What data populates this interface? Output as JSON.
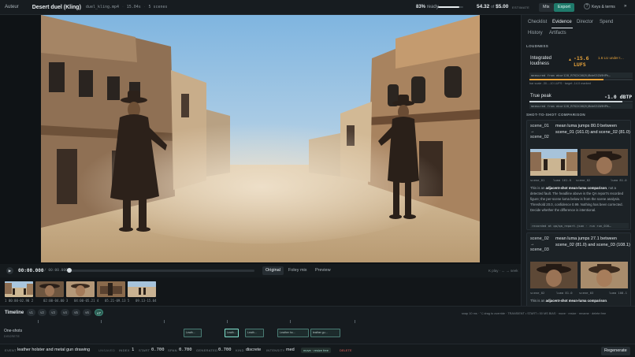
{
  "topbar": {
    "brand": "Auteur",
    "title": "Desert duel (Kling)",
    "file": "duel_kling.mp4",
    "duration": "15.04s",
    "scenes": "5 scenes",
    "ready_pct": "83%",
    "ready_label": "ready",
    "ready_fraction": 0.83,
    "cost_used": "54.32",
    "cost_of": "of",
    "cost_budget": "$5.00",
    "estimate": "ESTIMATE",
    "mix": "Mix",
    "export": "Export",
    "help": "?",
    "keys": "Keys & terms",
    "collapse": "»"
  },
  "viewer": {
    "timecode": "00:00.000",
    "duration": "/ 00:00.000",
    "playhead_fraction": 0.0,
    "tabs": [
      "Original",
      "Foley mix",
      "Preview"
    ],
    "hint": "K play · ← → seek"
  },
  "thumbs": [
    {
      "label": "1  00:00-02.90 2"
    },
    {
      "label": "02:00-04.00 3"
    },
    {
      "label": "04:00-05.21 4"
    },
    {
      "label": "05.21-09.13 5"
    },
    {
      "label": "09.13-15.04"
    }
  ],
  "timeline": {
    "title": "Timeline",
    "versions": [
      "v1",
      "v2",
      "v3",
      "v4",
      "v5",
      "v6",
      "v7"
    ],
    "active_version": "v7",
    "snap_hint": "snap 10 ms · ⌥ drag to override · TRANSIENT • START • 50 MS BIAS · move · resize · rename · delete free",
    "track": "One-shots",
    "track_sub": "DISCRETE",
    "clips": [
      "Leath…",
      "Leath…",
      "Leath…",
      "Leather ho…",
      "leather gu…"
    ]
  },
  "event": {
    "event_k": "EVENT",
    "event_v": "leather holster and metal gun drawing",
    "state": "UNSAVED",
    "index_k": "INDEX",
    "index_v": "1",
    "start_k": "START",
    "start_v": "0.700",
    "span_k": "SPAN",
    "span_v": "0.700",
    "gen_k": "GENERATED",
    "gen_v": "0.700",
    "kind_k": "KIND",
    "kind_v": "discrete",
    "int_k": "INTENSITY",
    "int_v": "med",
    "badge": "move · resize free",
    "delete": "DELETE",
    "regen": "Regenerate"
  },
  "panel": {
    "tabs": [
      "Checklist",
      "Evidence",
      "Director",
      "Spend",
      "History",
      "Artifacts"
    ],
    "active_tab": "Evidence",
    "loudness": {
      "section": "LOUDNESS",
      "name": "Integrated loudness",
      "value": "-15.6 LUFS",
      "delta": "1.6 LU under t…",
      "measured": "measured from ebur128_RTK2X1KQ5jBdeS3ZA9HPh…",
      "note": "bar scale -30...-10 LUFS · target -14.0 marked",
      "fraction": 0.72,
      "accent": "#e7a33b"
    },
    "peak": {
      "name": "True peak",
      "value": "-1.0 dBTP",
      "measured": "measured from ebur128_RTK2X1KQ5jBdeS3ZA9HPh…",
      "fraction": 0.9
    },
    "comparison": {
      "section": "SHOT-TO-SHOT COMPARISON",
      "cards": [
        {
          "scenes": "scene_01 → scene_02",
          "title": "mean luma jumps 80.0 between scene_01 (161.0) and scene_02 (81.0)",
          "cap_a": "scene_01",
          "cap_a2": "luma 161.0",
          "cap_b": "scene_02",
          "cap_b2": "luma 81.0",
          "para_intro": "This is an",
          "para_bold": "adjacent-shot mean-luma comparison",
          "para_rest": ", not a detected fault. The headline above is the QA report's recorded figure; the per-scene luma below is from the scene analysis. Threshold 20.0, confidence 0.99. Nothing has been corrected. Decide whether the difference is intentional.",
          "recorded": "recorded at qa/qa_report.json · run run_01K…"
        },
        {
          "scenes": "scene_02 → scene_03",
          "title": "mean luma jumps 27.1 between scene_02 (81.0) and scene_03 (108.1)",
          "cap_a": "scene_02",
          "cap_a2": "luma 81.0",
          "cap_b": "scene_03",
          "cap_b2": "luma 108.1",
          "para_intro": "This is an",
          "para_bold": "adjacent-shot mean-luma comparison",
          "para_rest": "."
        }
      ]
    }
  }
}
